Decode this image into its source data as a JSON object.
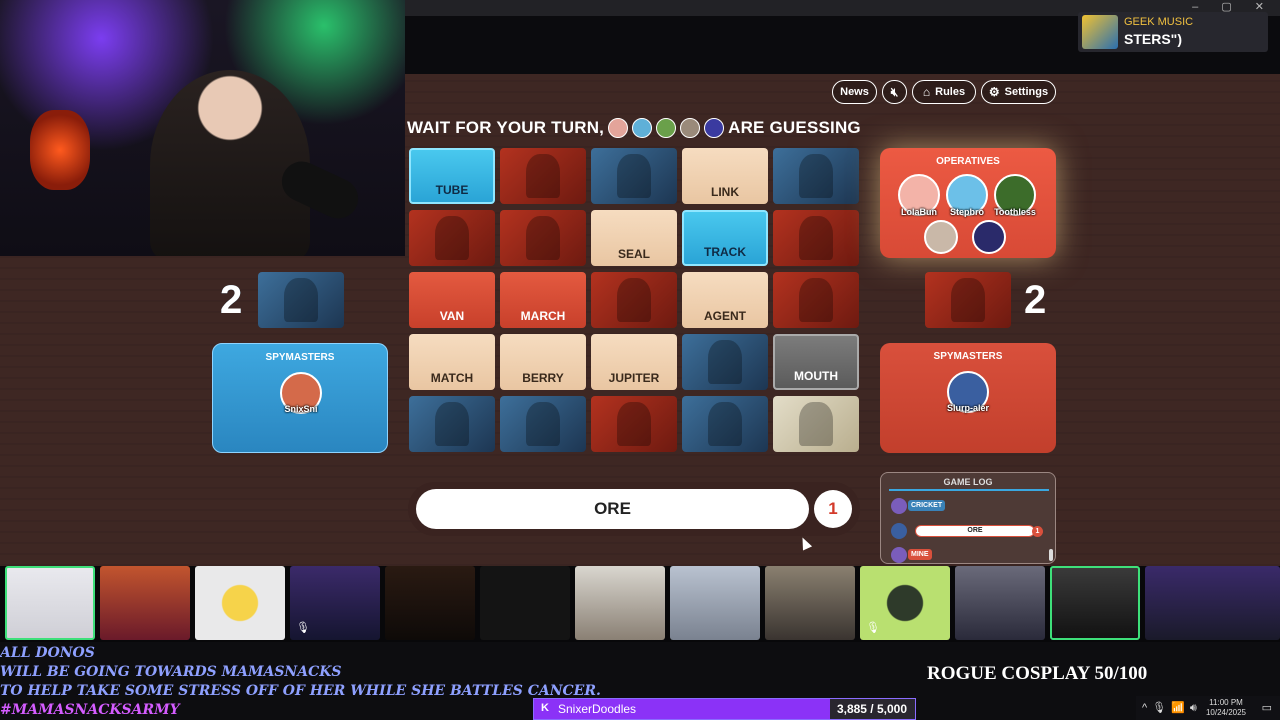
{
  "music": {
    "tag": "GEEK MUSIC",
    "title": "STERS\")"
  },
  "toolbar": {
    "news": "News",
    "rules": "Rules",
    "settings": "Settings"
  },
  "banner": {
    "prefix": "WAIT FOR YOUR TURN,",
    "suffix": "ARE GUESSING"
  },
  "board": [
    [
      {
        "word": "TUBE",
        "type": "blue"
      },
      {
        "word": "",
        "type": "red-agent"
      },
      {
        "word": "",
        "type": "blue-agent"
      },
      {
        "word": "LINK",
        "type": "beige"
      },
      {
        "word": "",
        "type": "blue-agent"
      }
    ],
    [
      {
        "word": "",
        "type": "red-agent"
      },
      {
        "word": "",
        "type": "red-agent"
      },
      {
        "word": "SEAL",
        "type": "beige"
      },
      {
        "word": "TRACK",
        "type": "blue"
      },
      {
        "word": "",
        "type": "red-agent"
      }
    ],
    [
      {
        "word": "VAN",
        "type": "red"
      },
      {
        "word": "MARCH",
        "type": "red"
      },
      {
        "word": "",
        "type": "red-agent"
      },
      {
        "word": "AGENT",
        "type": "beige"
      },
      {
        "word": "",
        "type": "red-agent"
      }
    ],
    [
      {
        "word": "MATCH",
        "type": "beige"
      },
      {
        "word": "BERRY",
        "type": "beige"
      },
      {
        "word": "JUPITER",
        "type": "beige"
      },
      {
        "word": "",
        "type": "blue-agent"
      },
      {
        "word": "MOUTH",
        "type": "gray"
      }
    ],
    [
      {
        "word": "",
        "type": "blue-agent"
      },
      {
        "word": "",
        "type": "blue-agent"
      },
      {
        "word": "",
        "type": "red-agent"
      },
      {
        "word": "",
        "type": "blue-agent"
      },
      {
        "word": "",
        "type": "assassin"
      }
    ]
  ],
  "red_team": {
    "operatives_title": "OPERATIVES",
    "operatives": [
      "LolaBun",
      "Stepbro",
      "Toothless"
    ],
    "spymasters_title": "SPYMASTERS",
    "spymaster": "Slurp-aler",
    "score": "2"
  },
  "blue_team": {
    "spymasters_title": "SPYMASTERS",
    "spymaster": "SnixSni",
    "score": "2"
  },
  "clue": {
    "word": "ORE",
    "number": "1"
  },
  "game_log": {
    "title": "GAME LOG",
    "entries": [
      {
        "text": "CRICKET",
        "color": "#3aa7e0"
      },
      {
        "text": "ORE",
        "number": "1"
      },
      {
        "text": "MINE",
        "color": "#d9503c"
      }
    ]
  },
  "stream": {
    "donos": [
      "ALL DONOS",
      "WILL BE GOING TOWARDS MAMASNACKS",
      "TO HELP TAKE SOME STRESS OFF OF HER WHILE SHE BATTLES CANCER."
    ],
    "hashtag": "#MAMASNACKSARMY",
    "rogue": "ROGUE COSPLAY 50/100",
    "goal_name": "SnixerDoodles",
    "goal_value": "3,885 / 5,000",
    "goal_fraction": 0.777
  },
  "tray": {
    "time": "11:00 PM",
    "date": "10/24/2025"
  },
  "colors": {
    "red": "#d9503c",
    "blue": "#2aa4d6",
    "beige": "#f0d2b2",
    "accent": "#8b32f7"
  }
}
